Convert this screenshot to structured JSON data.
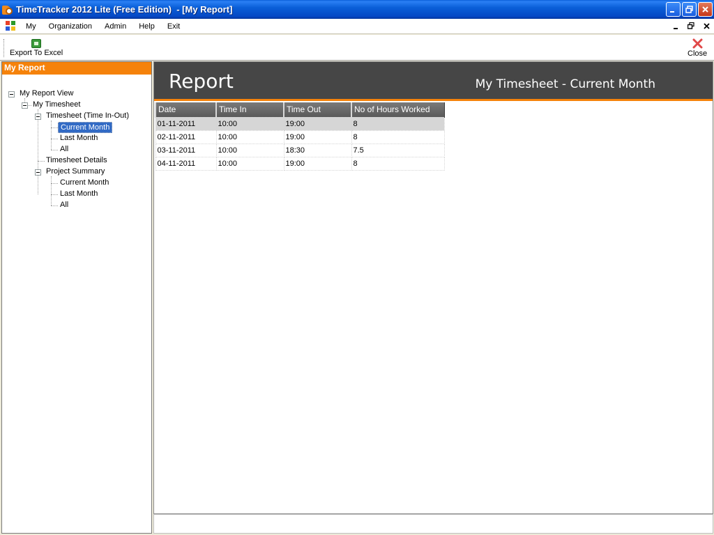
{
  "window": {
    "title": "TimeTracker 2012 Lite (Free Edition)  - [My Report]"
  },
  "menu": {
    "items": [
      "My",
      "Organization",
      "Admin",
      "Help",
      "Exit"
    ]
  },
  "toolbar": {
    "export_label": "Export To Excel",
    "close_label": "Close"
  },
  "left_panel": {
    "header": "My Report",
    "tree": {
      "root": "My Report View",
      "my_timesheet": "My Timesheet",
      "timesheet_in_out": "Timesheet (Time In-Out)",
      "ts_current": "Current Month",
      "ts_last": "Last Month",
      "ts_all": "All",
      "timesheet_details": "Timesheet Details",
      "project_summary": "Project Summary",
      "ps_current": "Current Month",
      "ps_last": "Last Month",
      "ps_all": "All"
    }
  },
  "report": {
    "title": "Report",
    "subtitle": "My Timesheet - Current Month",
    "columns": [
      "Date",
      "Time In",
      "Time Out",
      "No of Hours Worked"
    ],
    "rows": [
      [
        "01-11-2011",
        "10:00",
        "19:00",
        "8"
      ],
      [
        "02-11-2011",
        "10:00",
        "19:00",
        "8"
      ],
      [
        "03-11-2011",
        "10:00",
        "18:30",
        "7.5"
      ],
      [
        "04-11-2011",
        "10:00",
        "19:00",
        "8"
      ]
    ]
  },
  "colors": {
    "accent": "#f5820a",
    "header_bg": "#464646",
    "selection": "#316ac5"
  }
}
